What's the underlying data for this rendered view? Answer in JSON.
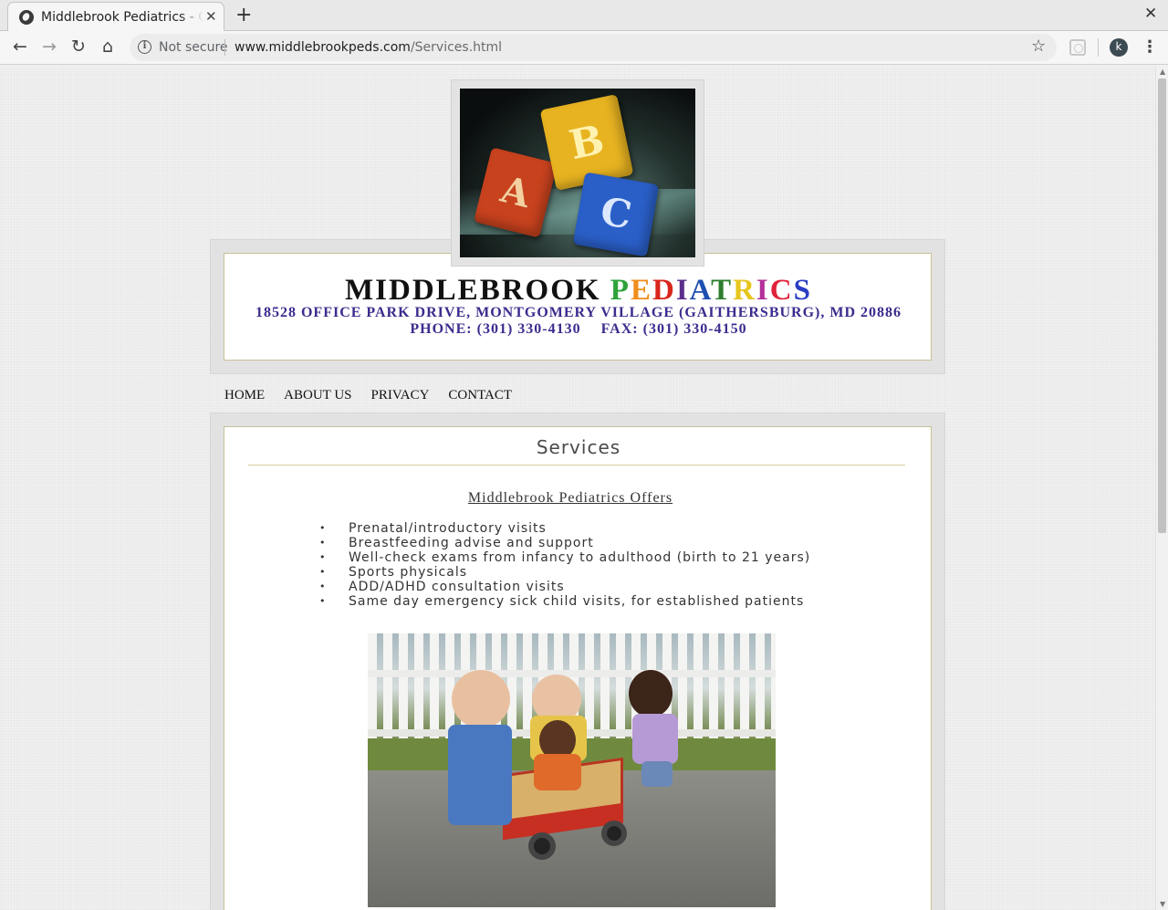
{
  "browser": {
    "tab_title": "Middlebrook Pediatrics - Go",
    "tab_close": "✕",
    "new_tab": "+",
    "window_close": "✕",
    "security_label": "Not secure",
    "url_domain": "www.middlebrookpeds.com",
    "url_path": "/Services.html",
    "profile_initial": "k"
  },
  "site": {
    "title_plain": "MIDDLEBROOK ",
    "title_colored_letters": [
      "P",
      "E",
      "D",
      "I",
      "A",
      "T",
      "R",
      "I",
      "C",
      "S"
    ],
    "address": "18528 OFFICE PARK DRIVE, MONTGOMERY VILLAGE (GAITHERSBURG), MD 20886",
    "phone": "PHONE: (301) 330-4130",
    "fax": "FAX: (301) 330-4150",
    "logo_letters": [
      "A",
      "B",
      "C"
    ]
  },
  "nav": {
    "items": [
      "HOME",
      "ABOUT US",
      "PRIVACY",
      "CONTACT"
    ]
  },
  "content": {
    "section_title": "Services",
    "offers_heading": "Middlebrook Pediatrics Offers",
    "services": [
      "Prenatal/introductory visits",
      "Breastfeeding advise and support",
      "Well-check exams from infancy to adulthood (birth to 21 years)",
      "Sports physicals",
      "ADD/ADHD consultation visits",
      "Same day emergency sick child visits, for established patients"
    ]
  },
  "icons": {
    "back": "back-arrow-icon",
    "forward": "forward-arrow-icon",
    "reload": "reload-icon",
    "home": "home-icon",
    "info": "info-icon",
    "bookmark": "star-icon",
    "menu": "kebab-menu-icon"
  }
}
